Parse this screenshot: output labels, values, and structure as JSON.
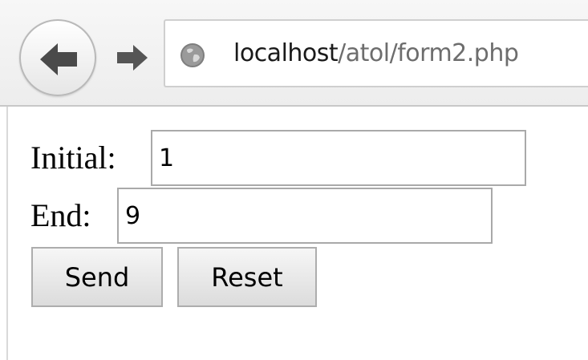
{
  "browser": {
    "url_host": "localhost",
    "url_path": "/atol/form2.php",
    "icons": {
      "back": "back-arrow-icon",
      "forward": "forward-arrow-icon",
      "site": "globe-icon"
    }
  },
  "form": {
    "initial_label": "Initial:",
    "initial_value": "1",
    "end_label": "End:",
    "end_value": "9",
    "send_label": "Send",
    "reset_label": "Reset"
  }
}
